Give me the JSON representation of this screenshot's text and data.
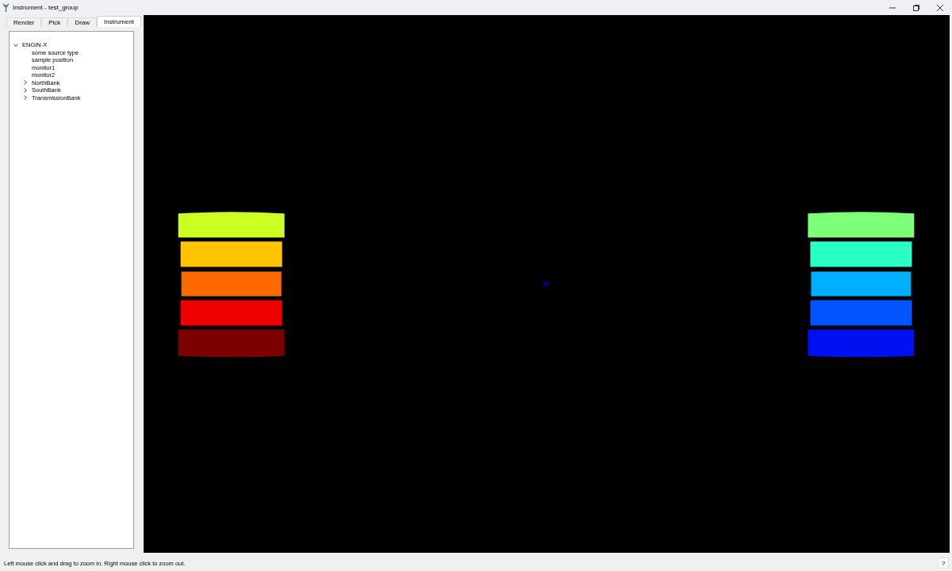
{
  "window": {
    "title": "Instrument - test_group"
  },
  "tabs": [
    {
      "label": "Render",
      "selected": false
    },
    {
      "label": "Pick",
      "selected": false
    },
    {
      "label": "Draw",
      "selected": false
    },
    {
      "label": "Instrument",
      "selected": true
    }
  ],
  "tree": [
    {
      "label": "ENGIN-X",
      "expanded": true,
      "children": [
        {
          "label": "some source type"
        },
        {
          "label": "sample position"
        },
        {
          "label": "monitor1"
        },
        {
          "label": "monitor2"
        },
        {
          "label": "NorthBank",
          "expanded": false
        },
        {
          "label": "SouthBank",
          "expanded": false
        },
        {
          "label": "TransmissionBank",
          "expanded": false
        }
      ]
    }
  ],
  "status_bar": {
    "message": "Left mouse click and drag to zoom in. Right mouse click to zoom out.",
    "help_button": "?"
  }
}
